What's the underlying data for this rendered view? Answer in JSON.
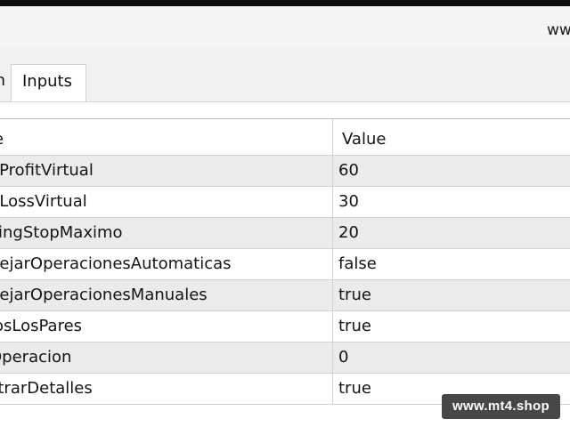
{
  "window": {
    "title_url": "ww"
  },
  "tabs": [
    {
      "label": "n"
    },
    {
      "label": "Inputs"
    }
  ],
  "table": {
    "headers": {
      "name": "le",
      "value": "Value"
    },
    "rows": [
      {
        "name": "eProfitVirtual",
        "value": "60"
      },
      {
        "name": "pLossVirtual",
        "value": "30"
      },
      {
        "name": "llingStopMaximo",
        "value": "20"
      },
      {
        "name": "nejarOperacionesAutomaticas",
        "value": "false"
      },
      {
        "name": "nejarOperacionesManuales",
        "value": "true"
      },
      {
        "name": "losLosPares",
        "value": "true"
      },
      {
        "name": "Operacion",
        "value": "0"
      },
      {
        "name": "strarDetalles",
        "value": "true"
      }
    ]
  },
  "watermark": {
    "text": "www.mt4.shop"
  },
  "colors": {
    "row_alt": "#ebebeb",
    "row_base": "#ffffff",
    "grid_line": "#d2d2d2",
    "title_bar": "#0d0d0d"
  }
}
